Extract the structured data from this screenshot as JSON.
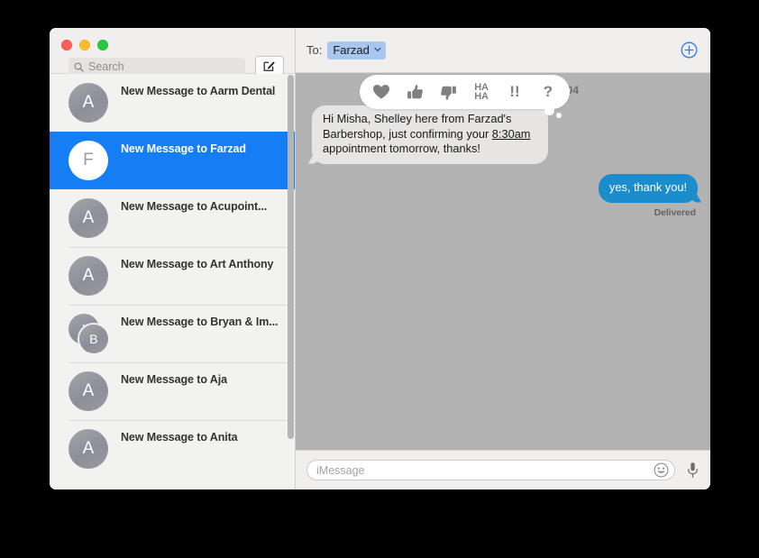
{
  "window": {
    "traffic_lights": [
      {
        "name": "close",
        "color": "#ff5f57"
      },
      {
        "name": "minimize",
        "color": "#ffbd2e"
      },
      {
        "name": "zoom",
        "color": "#28c840"
      }
    ]
  },
  "sidebar": {
    "search": {
      "placeholder": "Search",
      "value": "",
      "icon": "search-icon"
    },
    "compose_icon": "compose-icon",
    "conversations": [
      {
        "title": "New Message to Aarm Dental",
        "avatar": "A",
        "selected": false,
        "group": false
      },
      {
        "title": "New Message to Farzad",
        "avatar": "F",
        "selected": true,
        "group": false
      },
      {
        "title": "New Message to Acupoint...",
        "avatar": "A",
        "selected": false,
        "group": false
      },
      {
        "title": "New Message to Art Anthony",
        "avatar": "A",
        "selected": false,
        "group": false
      },
      {
        "title": "New Message to Bryan & Im...",
        "avatar": "I",
        "avatar2": "B",
        "selected": false,
        "group": true
      },
      {
        "title": "New Message to Aja",
        "avatar": "A",
        "selected": false,
        "group": false
      },
      {
        "title": "New Message to Anita",
        "avatar": "A",
        "selected": false,
        "group": false
      }
    ]
  },
  "conversation": {
    "to_label": "To:",
    "recipient": "Farzad",
    "recipient_chevron_icon": "chevron-down-icon",
    "add_contact_icon": "plus-circle-icon",
    "accent_color": "#167ef4",
    "timestamp": "104",
    "messages": [
      {
        "kind": "received",
        "text_before_link": "Hi Misha, Shelley here from Farzad's Barbershop, just confirming your ",
        "link_text": "8:30am",
        "text_after_link": " appointment tomorrow, thanks!",
        "full_text": "Hi Misha, Shelley here from Farzad's Barbershop, just confirming your 8:30am appointment tomorrow, thanks!"
      },
      {
        "kind": "sent",
        "full_text": "yes, thank you!",
        "status": "Delivered"
      }
    ],
    "tapback": {
      "items": [
        {
          "name": "heart",
          "glyph": "♥",
          "style": "icon"
        },
        {
          "name": "thumbs-up",
          "glyph": "👍",
          "style": "icon"
        },
        {
          "name": "thumbs-down",
          "glyph": "👎",
          "style": "icon"
        },
        {
          "name": "haha",
          "line1": "HA",
          "line2": "HA",
          "style": "text"
        },
        {
          "name": "exclamation",
          "glyph": "!!",
          "style": "big"
        },
        {
          "name": "question",
          "glyph": "?",
          "style": "big"
        }
      ]
    }
  },
  "composer": {
    "placeholder": "iMessage",
    "value": "",
    "emoji_icon": "smiley-icon",
    "dictation_icon": "microphone-icon"
  }
}
